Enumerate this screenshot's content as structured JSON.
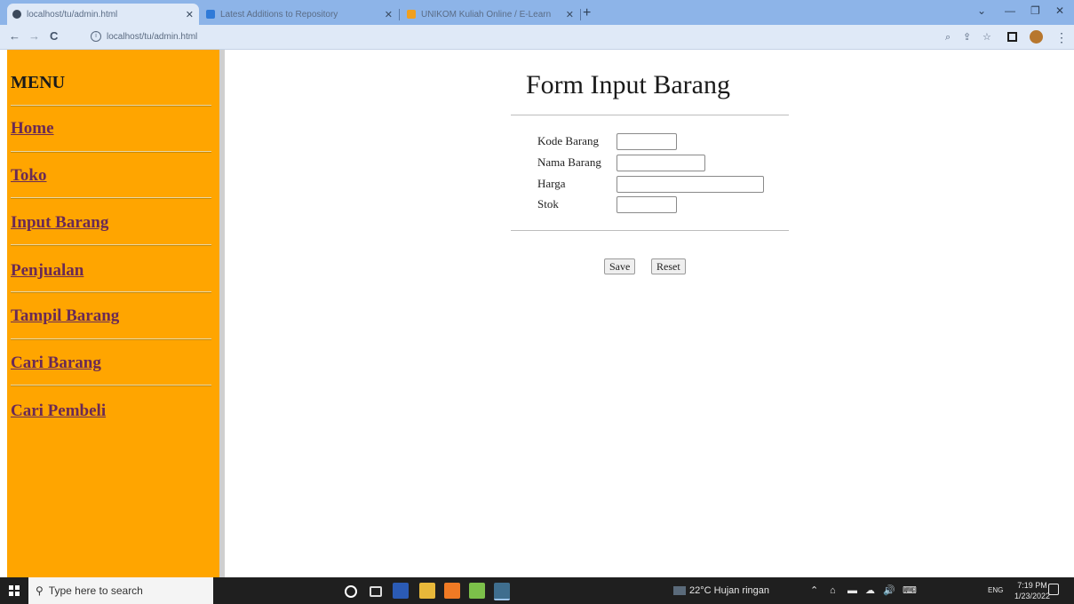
{
  "browser": {
    "tabs": [
      {
        "title": "localhost/tu/admin.html",
        "active": true
      },
      {
        "title": "Latest Additions to Repository",
        "active": false
      },
      {
        "title": "UNIKOM Kuliah Online / E-Learn",
        "active": false
      }
    ],
    "address": "localhost/tu/admin.html"
  },
  "sidebar": {
    "title": "MENU",
    "items": [
      {
        "label": "Home"
      },
      {
        "label": "Toko"
      },
      {
        "label": "Input Barang"
      },
      {
        "label": "Penjualan"
      },
      {
        "label": "Tampil Barang"
      },
      {
        "label": "Cari Barang"
      },
      {
        "label": "Cari Pembeli"
      }
    ],
    "background": "#ffa500",
    "link_color": "#6a2a55"
  },
  "form": {
    "title": "Form Input Barang",
    "fields": [
      {
        "label": "Kode Barang",
        "value": ""
      },
      {
        "label": "Nama Barang",
        "value": ""
      },
      {
        "label": "Harga",
        "value": ""
      },
      {
        "label": "Stok",
        "value": ""
      }
    ],
    "save_label": "Save",
    "reset_label": "Reset"
  },
  "taskbar": {
    "search_placeholder": "Type here to search",
    "weather": "22°C  Hujan ringan",
    "language": "ENG",
    "time": "7:19 PM",
    "date": "1/23/2022"
  }
}
